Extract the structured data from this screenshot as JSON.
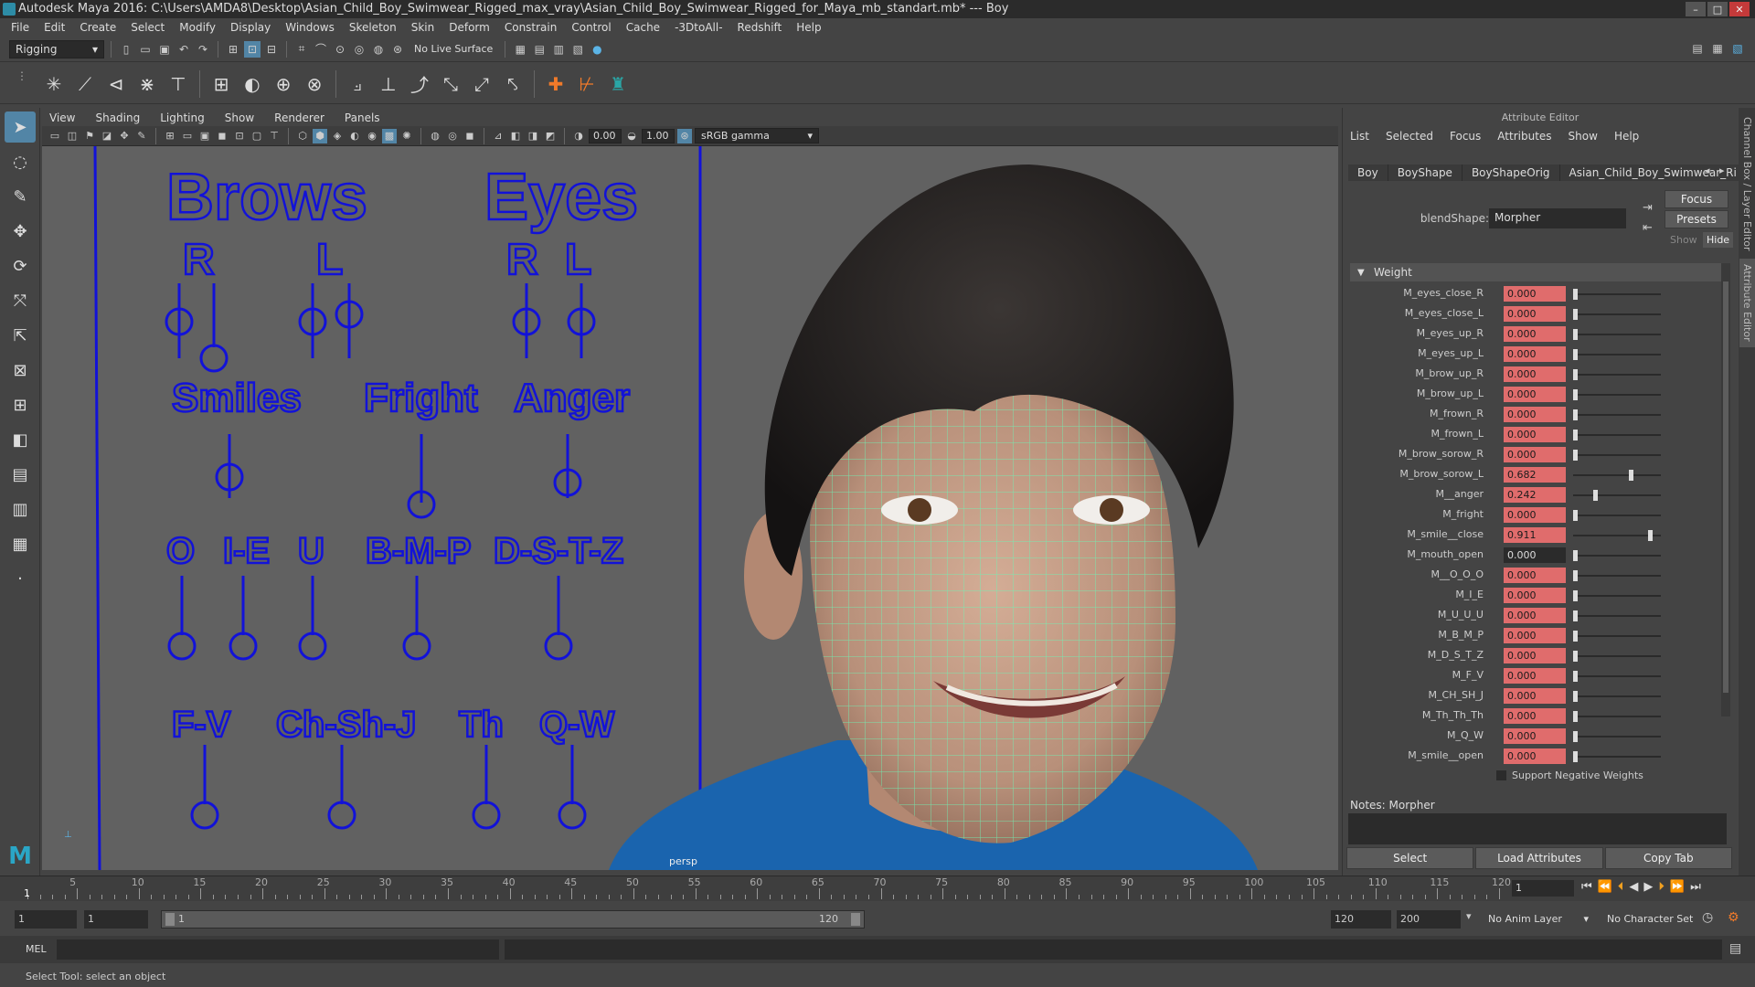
{
  "window": {
    "title": "Autodesk Maya 2016: C:\\Users\\AMDA8\\Desktop\\Asian_Child_Boy_Swimwear_Rigged_max_vray\\Asian_Child_Boy_Swimwear_Rigged_for_Maya_mb_standart.mb*   ---   Boy"
  },
  "menu": [
    "File",
    "Edit",
    "Create",
    "Select",
    "Modify",
    "Display",
    "Windows",
    "Skeleton",
    "Skin",
    "Deform",
    "Constrain",
    "Control",
    "Cache",
    "-3DtoAll-",
    "Redshift",
    "Help"
  ],
  "status": {
    "menuset": "Rigging",
    "live_surface": "No Live Surface"
  },
  "viewport": {
    "menu": [
      "View",
      "Shading",
      "Lighting",
      "Show",
      "Renderer",
      "Panels"
    ],
    "exposure": "0.00",
    "gamma": "1.00",
    "colorspace": "sRGB gamma",
    "camera": "persp",
    "labels": {
      "brows": "Brows",
      "eyes": "Eyes",
      "r1": "R",
      "l1": "L",
      "r2": "R",
      "l2": "L",
      "smiles": "Smiles",
      "fright": "Fright",
      "anger": "Anger",
      "o": "O",
      "ie": "I-E",
      "u": "U",
      "bmp": "B-M-P",
      "dstz": "D-S-T-Z",
      "fv": "F-V",
      "chshj": "Ch-Sh-J",
      "th": "Th",
      "qw": "Q-W"
    }
  },
  "attribute_editor": {
    "title": "Attribute Editor",
    "menu": [
      "List",
      "Selected",
      "Focus",
      "Attributes",
      "Show",
      "Help"
    ],
    "tabs": [
      "Boy",
      "BoyShape",
      "BoyShapeOrig",
      "Asian_Child_Boy_Swimwear_Ri"
    ],
    "focus_btn": "Focus",
    "presets_btn": "Presets",
    "show": "Show",
    "hide": "Hide",
    "blendshape_label": "blendShape:",
    "blendshape_value": "Morpher",
    "section": "Weight",
    "attrs": [
      {
        "name": "M_eyes_close_R",
        "value": "0.000",
        "pos": 0.0
      },
      {
        "name": "M_eyes_close_L",
        "value": "0.000",
        "pos": 0.0
      },
      {
        "name": "M_eyes_up_R",
        "value": "0.000",
        "pos": 0.0
      },
      {
        "name": "M_eyes_up_L",
        "value": "0.000",
        "pos": 0.0
      },
      {
        "name": "M_brow_up_R",
        "value": "0.000",
        "pos": 0.0
      },
      {
        "name": "M_brow_up_L",
        "value": "0.000",
        "pos": 0.0
      },
      {
        "name": "M_frown_R",
        "value": "0.000",
        "pos": 0.0
      },
      {
        "name": "M_frown_L",
        "value": "0.000",
        "pos": 0.0
      },
      {
        "name": "M_brow_sorow_R",
        "value": "0.000",
        "pos": 0.0
      },
      {
        "name": "M_brow_sorow_L",
        "value": "0.682",
        "pos": 0.682
      },
      {
        "name": "M__anger",
        "value": "0.242",
        "pos": 0.242
      },
      {
        "name": "M_fright",
        "value": "0.000",
        "pos": 0.0
      },
      {
        "name": "M_smile__close",
        "value": "0.911",
        "pos": 0.911
      },
      {
        "name": "M_mouth_open",
        "value": "0.000",
        "pos": 0.0,
        "plain": true
      },
      {
        "name": "M__O_O_O",
        "value": "0.000",
        "pos": 0.0
      },
      {
        "name": "M_I_E",
        "value": "0.000",
        "pos": 0.0
      },
      {
        "name": "M_U_U_U",
        "value": "0.000",
        "pos": 0.0
      },
      {
        "name": "M_B_M_P",
        "value": "0.000",
        "pos": 0.0
      },
      {
        "name": "M_D_S_T_Z",
        "value": "0.000",
        "pos": 0.0
      },
      {
        "name": "M_F_V",
        "value": "0.000",
        "pos": 0.0
      },
      {
        "name": "M_CH_SH_J",
        "value": "0.000",
        "pos": 0.0
      },
      {
        "name": "M_Th_Th_Th",
        "value": "0.000",
        "pos": 0.0
      },
      {
        "name": "M_Q_W",
        "value": "0.000",
        "pos": 0.0
      },
      {
        "name": "M_smile__open",
        "value": "0.000",
        "pos": 0.0
      }
    ],
    "support_negative": "Support Negative Weights",
    "notes_label": "Notes:",
    "notes_value": "Morpher",
    "bottom_buttons": [
      "Select",
      "Load Attributes",
      "Copy Tab"
    ],
    "side_tabs": [
      "Channel Box / Layer Editor",
      "Attribute Editor"
    ]
  },
  "timeline": {
    "ticks": [
      "5",
      "10",
      "15",
      "20",
      "25",
      "30",
      "35",
      "40",
      "45",
      "50",
      "55",
      "60",
      "65",
      "70",
      "75",
      "80",
      "85",
      "90",
      "95",
      "100",
      "105",
      "110",
      "115",
      "120"
    ],
    "start": "1",
    "current": "1"
  },
  "range": {
    "start": "1",
    "start2": "1",
    "bar_start": "1",
    "bar_end": "120",
    "end": "120",
    "end2": "200",
    "anim_layer": "No Anim Layer",
    "char_set": "No Character Set"
  },
  "cmd": {
    "lang": "MEL"
  },
  "help": "Select Tool: select an object",
  "colors": {
    "rig_blue": "#1212d8",
    "attr_keyed": "#e06c6c",
    "wire": "#6ff2b4"
  }
}
